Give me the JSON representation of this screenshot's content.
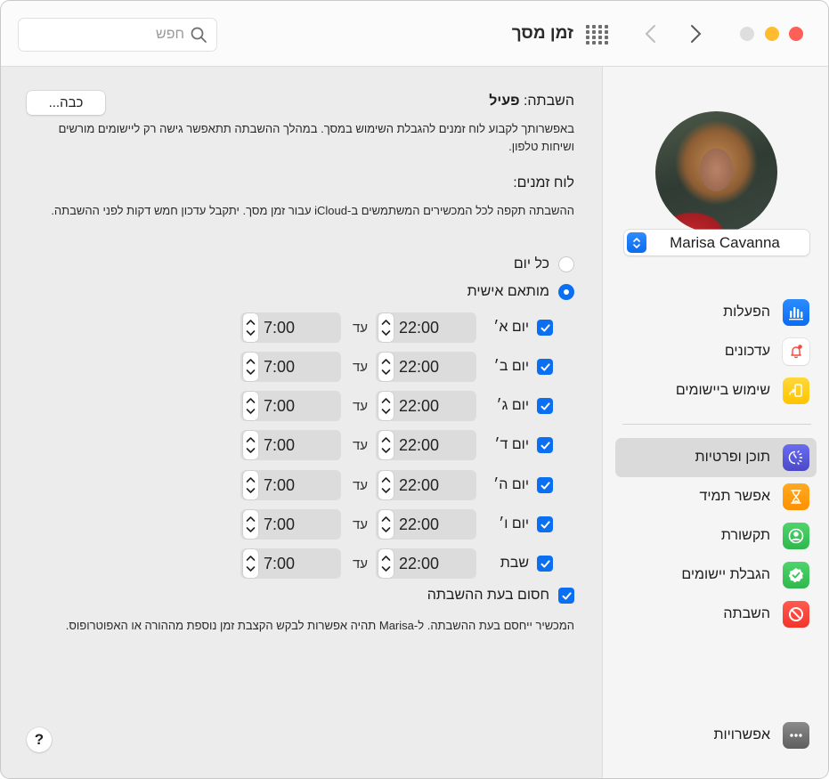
{
  "window": {
    "title": "זמן מסך",
    "search": {
      "placeholder": "חפש",
      "value": ""
    }
  },
  "sidebar": {
    "user": {
      "name": "Marisa Cavanna"
    },
    "items": [
      {
        "label": "הפעלות",
        "icon": "bar-chart-icon",
        "color": "#1a7cf5",
        "selected": false
      },
      {
        "label": "עדכונים",
        "icon": "bell-icon",
        "color": "#ffffff",
        "selected": false
      },
      {
        "label": "שימוש ביישומים",
        "icon": "app-pickup-icon",
        "color": "#ffcc00",
        "selected": false
      },
      {
        "label": "תוכן ופרטיות",
        "icon": "content-privacy-icon",
        "color": "#5b5ce0",
        "selected": true
      },
      {
        "label": "אפשר תמיד",
        "icon": "hourglass-icon",
        "color": "#ff9f0a",
        "selected": false
      },
      {
        "label": "תקשורת",
        "icon": "person-circle-icon",
        "color": "#34c759",
        "selected": false
      },
      {
        "label": "הגבלת יישומים",
        "icon": "check-badge-icon",
        "color": "#34c759",
        "selected": false
      },
      {
        "label": "השבתה",
        "icon": "no-entry-icon",
        "color": "#ff3b30",
        "selected": false
      }
    ],
    "options": {
      "label": "אפשרויות",
      "icon": "ellipsis-icon"
    }
  },
  "main": {
    "status_prefix": "השבתה:",
    "status_value": "פעיל",
    "turn_off_button": "כבה...",
    "description": "באפשרותך לקבוע לוח זמנים להגבלת השימוש במסך. במהלך ההשבתה תתאפשר גישה רק ליישומים מורשים ושיחות טלפון.",
    "schedule_title": "לוח זמנים:",
    "schedule_description": "ההשבתה תקפה לכל המכשירים המשתמשים ב-iCloud עבור זמן מסך. יתקבל עדכון חמש דקות לפני ההשבתה.",
    "schedule_options": [
      {
        "label": "כל יום",
        "selected": false
      },
      {
        "label": "מותאם אישית",
        "selected": true
      }
    ],
    "until_label": "עד",
    "days": [
      {
        "label": "יום א׳",
        "checked": true,
        "start": "22:00",
        "end": "7:00"
      },
      {
        "label": "יום ב׳",
        "checked": true,
        "start": "22:00",
        "end": "7:00"
      },
      {
        "label": "יום ג׳",
        "checked": true,
        "start": "22:00",
        "end": "7:00"
      },
      {
        "label": "יום ד׳",
        "checked": true,
        "start": "22:00",
        "end": "7:00"
      },
      {
        "label": "יום ה׳",
        "checked": true,
        "start": "22:00",
        "end": "7:00"
      },
      {
        "label": "יום ו׳",
        "checked": true,
        "start": "22:00",
        "end": "7:00"
      },
      {
        "label": "שבת",
        "checked": true,
        "start": "22:00",
        "end": "7:00"
      }
    ],
    "block_at_downtime": {
      "label": "חסום בעת ההשבתה",
      "checked": true
    },
    "block_description": "המכשיר ייחסם בעת ההשבתה. ל-Marisa תהיה אפשרות לבקש הקצבת זמן נוספת מההורה או האפוטרופוס.",
    "help_label": "?"
  }
}
